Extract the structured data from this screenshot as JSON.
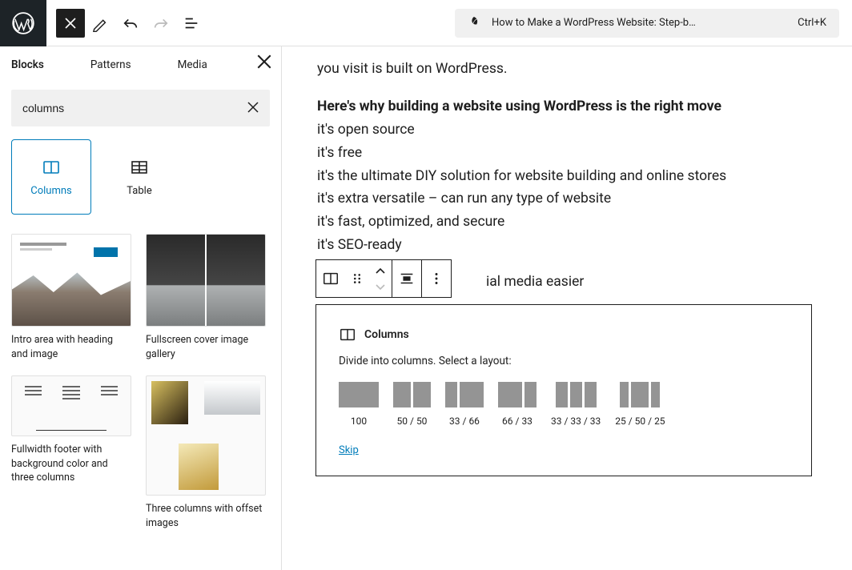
{
  "topbar": {
    "doc_title": "How to Make a WordPress Website: Step-b…",
    "shortcut": "Ctrl+K"
  },
  "inserter": {
    "tabs": {
      "blocks": "Blocks",
      "patterns": "Patterns",
      "media": "Media"
    },
    "search_value": "columns",
    "blocks": {
      "columns": "Columns",
      "table": "Table"
    },
    "patterns": {
      "intro": "Intro area with heading and image",
      "cover": "Fullscreen cover image gallery",
      "footer": "Fullwidth footer with background color and three columns",
      "offset": "Three columns with offset images"
    }
  },
  "content": {
    "p0": "you visit is built on WordPress.",
    "p1": "Here's why building a website using WordPress is the right move",
    "l1": "it's open source",
    "l2": "it's free",
    "l3": "it's the ultimate DIY solution for website building and online stores",
    "l4": "it's extra versatile – can run any type of website",
    "l5": "it's fast, optimized, and secure",
    "l6": "it's SEO-ready",
    "l7_tail": "ial media easier"
  },
  "placeholder": {
    "title": "Columns",
    "instr": "Divide into columns. Select a layout:",
    "layouts": {
      "l100": "100",
      "l5050": "50 / 50",
      "l3366": "33 / 66",
      "l6633": "66 / 33",
      "l333333": "33 / 33 / 33",
      "l255025": "25 / 50 / 25"
    },
    "skip": "Skip"
  }
}
